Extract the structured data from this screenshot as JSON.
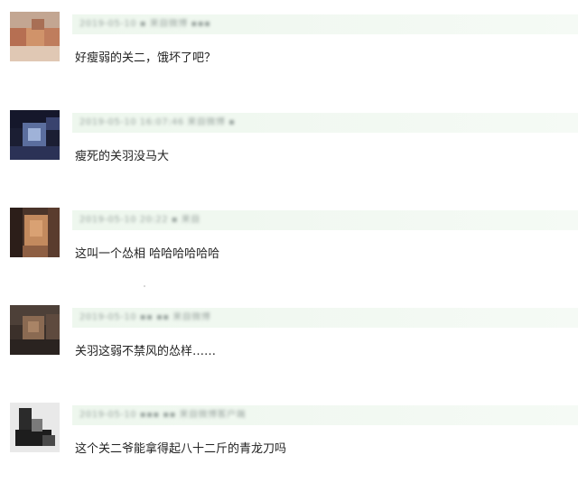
{
  "comments": [
    {
      "meta": "2019-05-10 ▪ 来自微博 ▪▪▪",
      "text": "好瘦弱的关二，饿坏了吧？"
    },
    {
      "meta": "2019-05-10 16:07:46 来自微博 ▪",
      "text": "瘦死的关羽没马大"
    },
    {
      "meta": "2019-05-10 20:22 ▪ 来自",
      "text": "这叫一个怂相 哈哈哈哈哈哈"
    },
    {
      "meta": "2019-05-10 ▪▪ ▪▪ 来自微博",
      "text": "关羽这弱不禁风的怂样……"
    },
    {
      "meta": "2019-05-10 ▪▪▪ ▪▪ 来自微博客户端",
      "text": "这个关二爷能拿得起八十二斤的青龙刀吗"
    }
  ]
}
